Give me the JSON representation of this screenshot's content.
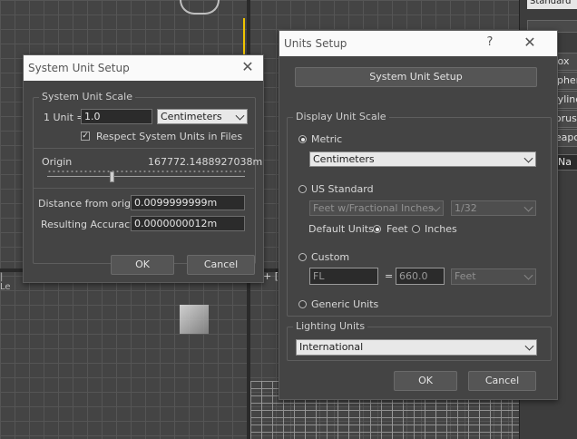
{
  "background": {
    "command_panel": {
      "dropdown_value": "Standard",
      "object_buttons": [
        "Box",
        "Sphere",
        "Cylinder",
        "Torus",
        "Teapot"
      ],
      "name_field": "Na"
    },
    "viewport_label": "+ [",
    "axis_label": "| Le"
  },
  "system_unit_setup": {
    "title": "System Unit Setup",
    "scale_group_label": "System Unit Scale",
    "unit_label": "1 Unit =",
    "unit_value": "1.0",
    "unit_type": "Centimeters",
    "respect_checked": true,
    "respect_label": "Respect System Units in Files",
    "origin_label": "Origin",
    "origin_value": "167772.1488927038m",
    "distance_label": "Distance from origin:",
    "distance_value": "0.0099999999m",
    "accuracy_label": "Resulting Accuracy:",
    "accuracy_value": "0.0000000012m",
    "ok_label": "OK",
    "cancel_label": "Cancel"
  },
  "units_setup": {
    "title": "Units Setup",
    "help_glyph": "?",
    "system_button_label": "System Unit Setup",
    "display_group_label": "Display Unit Scale",
    "metric_label": "Metric",
    "metric_value": "Centimeters",
    "us_label": "US Standard",
    "us_value": "Feet w/Fractional Inches",
    "us_fraction": "1/32",
    "default_units_label": "Default Units:",
    "feet_label": "Feet",
    "inches_label": "Inches",
    "custom_label": "Custom",
    "custom_name": "FL",
    "custom_equals": "=",
    "custom_value": "660.0",
    "custom_unit": "Feet",
    "generic_label": "Generic Units",
    "selected_scale": "Metric",
    "lighting_group_label": "Lighting Units",
    "lighting_value": "International",
    "ok_label": "OK",
    "cancel_label": "Cancel"
  },
  "colors": {
    "dialog_bg": "#444444",
    "titlebar_bg": "#fafafa",
    "dropdown_bg": "#e8e8e8"
  }
}
